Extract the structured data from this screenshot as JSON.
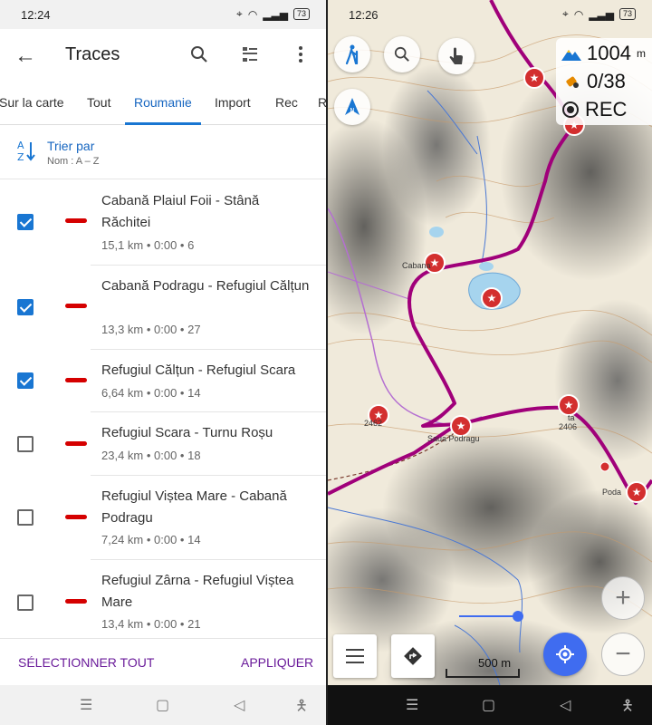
{
  "left": {
    "status": {
      "time": "12:24",
      "battery": "73"
    },
    "appbar": {
      "title": "Traces"
    },
    "tabs": [
      "Sur la carte",
      "Tout",
      "Roumanie",
      "Import",
      "Rec",
      "R"
    ],
    "active_tab": "Roumanie",
    "sort": {
      "label": "Trier par",
      "sub": "Nom : A – Z"
    },
    "traces": [
      {
        "name": "Cabană Plaiul Foii - Stână Răchitei",
        "info": "15,1 km • 0:00 • 6",
        "checked": true
      },
      {
        "name": "Cabană Podragu - Refugiul Călțun",
        "info": "13,3 km • 0:00 • 27",
        "checked": true
      },
      {
        "name": "Refugiul Călțun - Refugiul Scara",
        "info": "6,64 km • 0:00 • 14",
        "checked": true
      },
      {
        "name": "Refugiul Scara - Turnu Roșu",
        "info": "23,4 km • 0:00 • 18",
        "checked": false
      },
      {
        "name": "Refugiul Viștea Mare - Cabană Podragu",
        "info": "7,24 km • 0:00 • 14",
        "checked": false
      },
      {
        "name": "Refugiul Zârna - Refugiul Viștea Mare",
        "info": "13,4 km • 0:00 • 21",
        "checked": false
      }
    ],
    "actions": {
      "select_all": "SÉLECTIONNER TOUT",
      "apply": "APPLIQUER"
    }
  },
  "right": {
    "status": {
      "time": "12:26",
      "battery": "73"
    },
    "info": {
      "altitude": "1004",
      "altitude_unit": "m",
      "satellites": "0/38",
      "rec": "REC"
    },
    "map_labels": {
      "cabana": "Cabana",
      "saua": "Saua Podragu",
      "poda": "Poda",
      "peak1": "2462",
      "peak2": "2406",
      "sta": "ta"
    },
    "scale": "500 m",
    "colors": {
      "track": "#a0007a",
      "marker": "#d32f2f",
      "accent": "#3f6cf0"
    }
  }
}
